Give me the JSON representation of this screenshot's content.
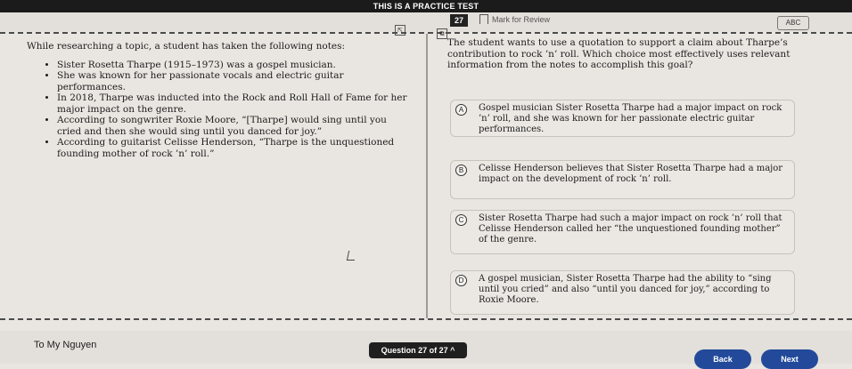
{
  "topbar": {
    "practice_label": "THIS IS A PRACTICE TEST"
  },
  "header": {
    "question_number": "27",
    "mark_for_review": "Mark for Review",
    "abc_label": "ABC"
  },
  "passage": {
    "intro": "While researching a topic, a student has taken the following notes:",
    "bullets": [
      "Sister Rosetta Tharpe (1915–1973) was a gospel musician.",
      "She was known for her passionate vocals and electric guitar performances.",
      "In 2018, Tharpe was inducted into the Rock and Roll Hall of Fame for her major impact on the genre.",
      "According to songwriter Roxie Moore, “[Tharpe] would sing until you cried and then she would sing until you danced for joy.”",
      "According to guitarist Celisse Henderson, “Tharpe is the unquestioned founding mother of rock ’n’ roll.”"
    ]
  },
  "question": {
    "stem": "The student wants to use a quotation to support a claim about Tharpe’s contribution to rock ’n’ roll. Which choice most effectively uses relevant information from the notes to accomplish this goal?",
    "choices": [
      {
        "letter": "A",
        "text": "Gospel musician Sister Rosetta Tharpe had a major impact on rock ’n’ roll, and she was known for her passionate electric guitar performances."
      },
      {
        "letter": "B",
        "text": "Celisse Henderson believes that Sister Rosetta Tharpe had a major impact on the development of rock ’n’ roll."
      },
      {
        "letter": "C",
        "text": "Sister Rosetta Tharpe had such a major impact on rock ’n’ roll that Celisse Henderson called her “the unquestioned founding mother” of the genre."
      },
      {
        "letter": "D",
        "text": "A gospel musician, Sister Rosetta Tharpe had the ability to “sing until you cried” and also “until you danced for joy,” according to Roxie Moore."
      }
    ]
  },
  "footer": {
    "user_name": "To My Nguyen",
    "question_nav": "Question 27 of 27 ^",
    "back_label": "Back",
    "next_label": "Next"
  }
}
